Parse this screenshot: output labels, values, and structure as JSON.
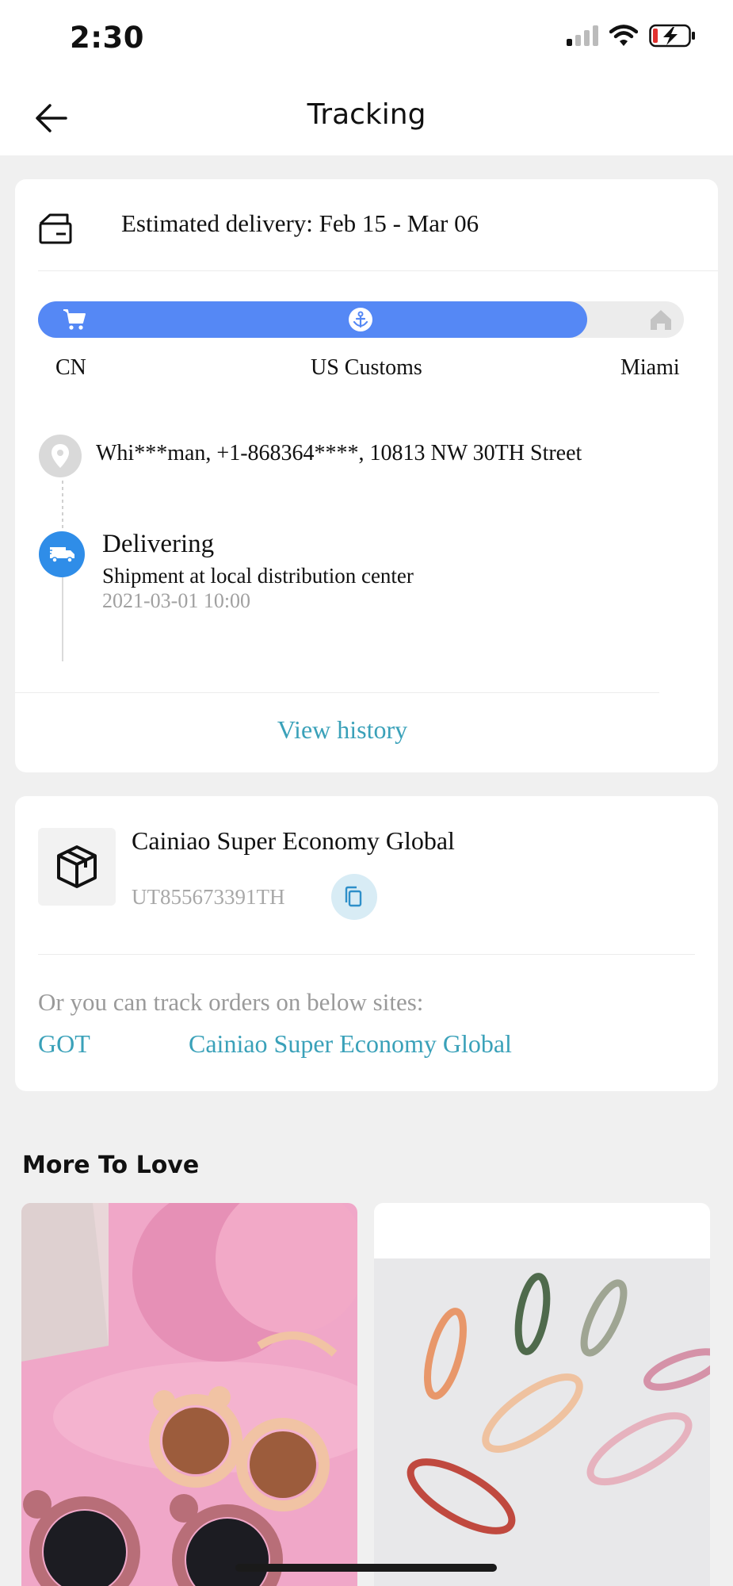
{
  "status_bar": {
    "time": "2:30"
  },
  "header": {
    "title": "Tracking"
  },
  "tracking": {
    "estimated_delivery": "Estimated delivery: Feb 15 - Mar 06",
    "progress_fraction": 0.85,
    "stops": [
      {
        "label": "CN",
        "icon": "cart-icon"
      },
      {
        "label": "US Customs",
        "icon": "anchor-icon"
      },
      {
        "label": "Miami",
        "icon": "home-icon"
      }
    ],
    "address": "Whi***man,  +1-868364****,  10813 NW 30TH Street",
    "event": {
      "title": "Delivering",
      "description": "Shipment at local distribution center",
      "time": "2021-03-01 10:00"
    },
    "view_history": "View history"
  },
  "carrier": {
    "name": "Cainiao Super Economy Global",
    "tracking_number": "UT855673391TH",
    "other_sites_prompt": "Or you can track orders on below sites:",
    "sites": [
      "GOT",
      "Cainiao Super Economy Global"
    ]
  },
  "recommendations": {
    "title": "More To Love"
  },
  "colors": {
    "accent": "#5588f5",
    "link": "#3aa1b9",
    "truck": "#2f8de8"
  }
}
